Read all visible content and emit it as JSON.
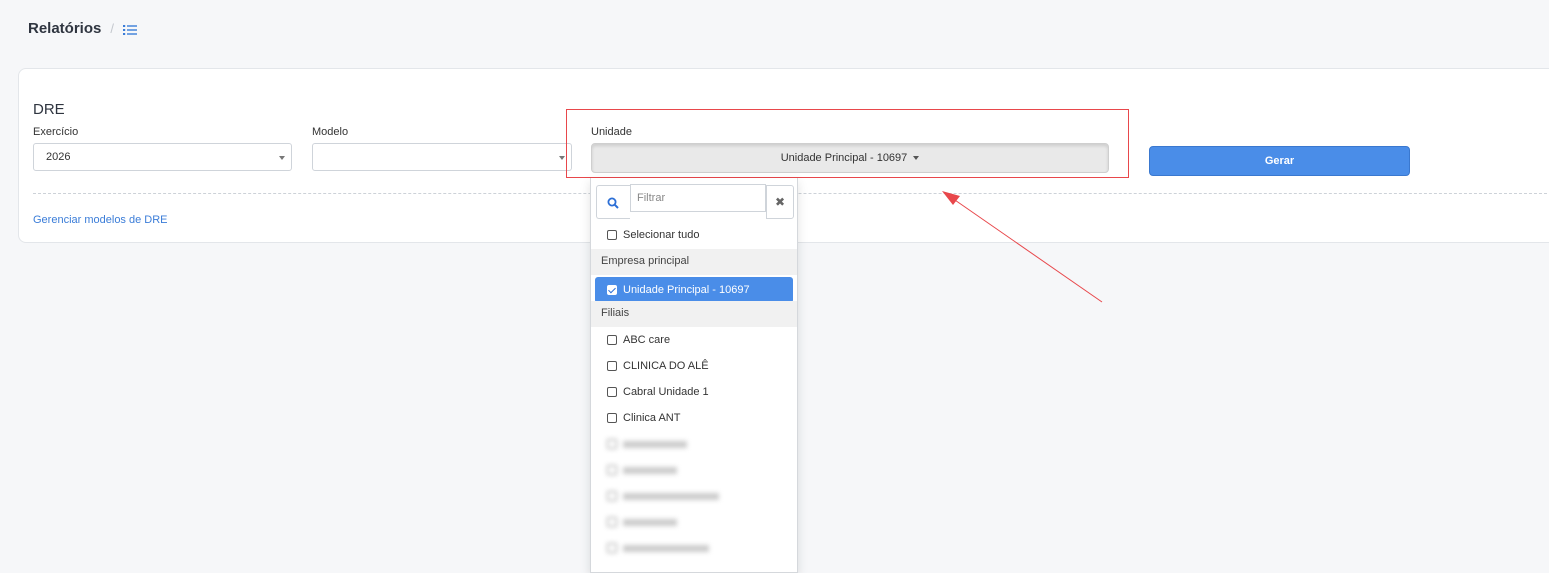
{
  "breadcrumb": {
    "title": "Relatórios",
    "separator": "/",
    "icon": "list-icon"
  },
  "card": {
    "title": "DRE",
    "exercicio": {
      "label": "Exercício",
      "value": "2026"
    },
    "modelo": {
      "label": "Modelo",
      "value": ""
    },
    "unidade": {
      "label": "Unidade",
      "selected": "Unidade Principal - 10697"
    },
    "gerar_label": "Gerar",
    "manage_link": "Gerenciar modelos de DRE"
  },
  "dropdown": {
    "filter_placeholder": "Filtrar",
    "clear_icon": "✖",
    "select_all": "Selecionar tudo",
    "groups": [
      {
        "header": "Empresa principal",
        "items": [
          "Unidade Principal - 10697"
        ]
      },
      {
        "header": "Filiais",
        "items": [
          "ABC care",
          "CLINICA DO ALÊ",
          "Cabral Unidade 1",
          "Clinica ANT"
        ]
      }
    ]
  },
  "colors": {
    "accent": "#4a8de8",
    "annotation": "#e8474b",
    "link": "#3b7dd8"
  }
}
